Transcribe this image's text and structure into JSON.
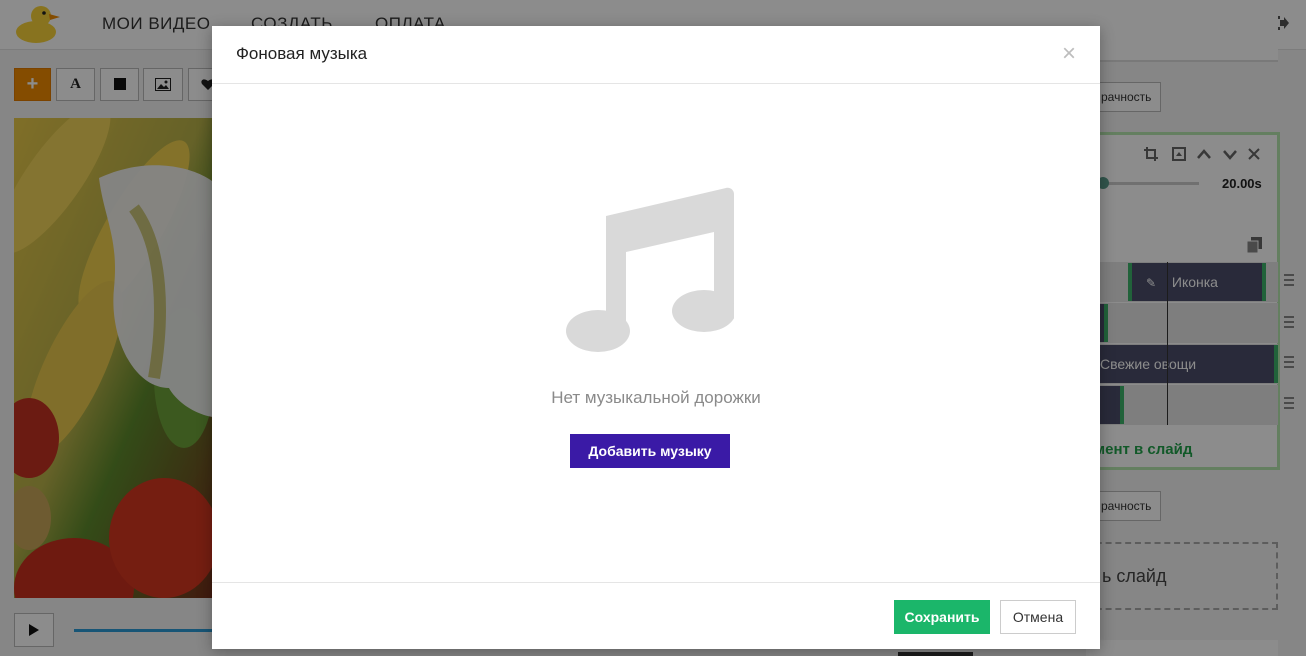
{
  "app": {
    "nav": [
      "МОИ ВИДЕО",
      "СОЗДАТЬ",
      "ОПЛАТА"
    ],
    "top_icons": [
      "help-icon",
      "bell-icon",
      "gear-icon",
      "logout-icon"
    ],
    "toolbar": {
      "add_label": "+",
      "text_label": "A"
    },
    "right_panel": {
      "transparency_label": "рачность",
      "duration_label": "20.00s",
      "timeline_clips": [
        "Иконка",
        "Свежие овощи"
      ],
      "add_element_label": "мент в слайд",
      "transparency_label_2": "рачность",
      "add_slide_label": "ь слайд"
    }
  },
  "modal": {
    "title": "Фоновая музыка",
    "close_label": "×",
    "empty_text": "Нет музыкальной дорожки",
    "add_music_label": "Добавить музыку",
    "save_label": "Сохранить",
    "cancel_label": "Отмена"
  },
  "colors": {
    "accent_orange": "#f08a00",
    "add_music_purple": "#3a1aa6",
    "save_green": "#1bb66a",
    "progress_blue": "#2a9bd8"
  }
}
